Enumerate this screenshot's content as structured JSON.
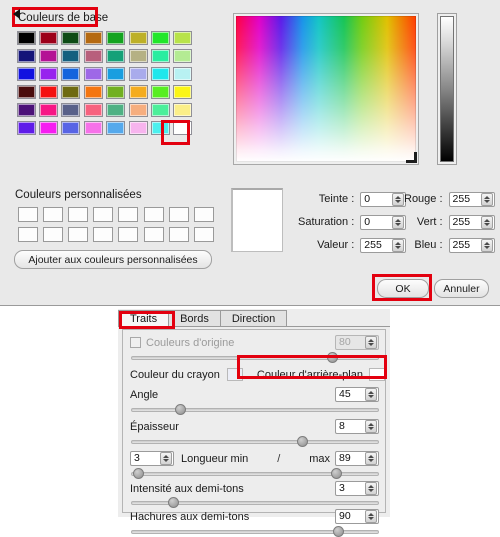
{
  "color_dialog": {
    "base_colors_label": "Couleurs de base",
    "custom_colors_label": "Couleurs personnalisées",
    "add_custom_button": "Ajouter aux couleurs personnalisées",
    "ok_label": "OK",
    "cancel_label": "Annuler",
    "base_colors": [
      [
        "#000000",
        "#9c0019",
        "#0d4b15",
        "#b56a12",
        "#14a320",
        "#bdb028",
        "#22e62b",
        "#b8e34a"
      ],
      [
        "#141479",
        "#b41295",
        "#14607f",
        "#b85f7c",
        "#15a178",
        "#b5b184",
        "#2aedA0",
        "#b4eb93"
      ],
      [
        "#1212e0",
        "#9822ee",
        "#1464dd",
        "#9e68e7",
        "#199ee0",
        "#a9abec",
        "#1fe7ec",
        "#b8f1f2"
      ],
      [
        "#4a0c0c",
        "#f41111",
        "#6e6a11",
        "#f47611",
        "#72b021",
        "#f4ac1f",
        "#58ee22",
        "#fbf516"
      ],
      [
        "#4c1279",
        "#f71685",
        "#596189",
        "#f7627f",
        "#4fb184",
        "#f6ae7f",
        "#4cef9a",
        "#fbef88"
      ],
      [
        "#5f1ce9",
        "#f61cf1",
        "#5864e5",
        "#f671e9",
        "#55a9ec",
        "#f7b4ee",
        "#4cf0ee",
        "#ffffff"
      ]
    ],
    "selected_base_color": "#ffffff",
    "custom_slots_rows": 2,
    "custom_slots_per_row": 8,
    "preview_color": "#ffffff",
    "hsv": [
      {
        "label": "Teinte :",
        "value": "0"
      },
      {
        "label": "Saturation :",
        "value": "0"
      },
      {
        "label": "Valeur :",
        "value": "255"
      }
    ],
    "rgb": [
      {
        "label": "Rouge :",
        "value": "255"
      },
      {
        "label": "Vert :",
        "value": "255"
      },
      {
        "label": "Bleu :",
        "value": "255"
      }
    ]
  },
  "traits_panel": {
    "tabs": [
      {
        "label": "Traits",
        "active": true
      },
      {
        "label": "Bords",
        "active": false
      },
      {
        "label": "Direction",
        "active": false
      }
    ],
    "origin_colors": {
      "label": "Couleurs d'origine",
      "value": "80",
      "checked": false,
      "disabled": true,
      "slider_pct": 80
    },
    "pencil_color": {
      "label": "Couleur du crayon",
      "swatch": "#eceef7"
    },
    "background_color": {
      "label": "Couleur d'arrière-plan",
      "swatch": "#ffffff"
    },
    "sliders": [
      {
        "label": "Angle",
        "value": "45",
        "pct": 18
      },
      {
        "label": "Épaisseur",
        "value": "8",
        "pct": 68
      },
      {
        "label": "Intensité aux demi-tons",
        "value": "3",
        "pct": 15
      },
      {
        "label": "Hachures aux demi-tons",
        "value": "90",
        "pct": 82
      }
    ],
    "length_row": {
      "min_value": "3",
      "label": "Longueur min",
      "separator": "/",
      "max_label": "max",
      "max_value": "89",
      "min_pct": 2,
      "max_pct": 82
    }
  },
  "annotations": {
    "highlight_color": "#e3000f"
  }
}
